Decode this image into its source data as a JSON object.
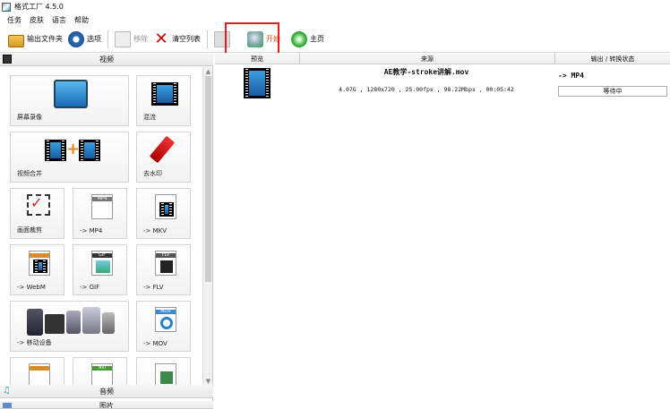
{
  "window": {
    "title": "格式工厂 4.5.0"
  },
  "menu": [
    "任务",
    "皮肤",
    "语言",
    "帮助"
  ],
  "toolbar": {
    "output_folder": "输出文件夹",
    "options": "选项",
    "remove": "移除",
    "clear_list": "清空列表",
    "reorder": "",
    "start": "开始",
    "home": "主页"
  },
  "sections": {
    "video": "视频",
    "audio": "音频",
    "image": "图片"
  },
  "tiles": [
    {
      "label": "屏幕录像",
      "icon": "screen-record-icon"
    },
    {
      "label": "混流",
      "icon": "mux-icon"
    },
    {
      "label": "视频合并",
      "icon": "video-merge-icon"
    },
    {
      "label": "去水印",
      "icon": "remove-watermark-icon"
    },
    {
      "label": "画面裁剪",
      "icon": "crop-icon"
    },
    {
      "label": "-> MP4",
      "icon": "mp4-icon"
    },
    {
      "label": "-> MKV",
      "icon": "mkv-icon"
    },
    {
      "label": "-> WebM",
      "icon": "webm-icon"
    },
    {
      "label": "-> GIF",
      "icon": "gif-icon"
    },
    {
      "label": "-> FLV",
      "icon": "flv-icon"
    },
    {
      "label": "-> 移动设备",
      "icon": "mobile-device-icon"
    },
    {
      "label": "-> MOV",
      "icon": "mov-icon"
    },
    {
      "label": "",
      "icon": "format-icon"
    },
    {
      "label": "",
      "icon": "avi-icon"
    },
    {
      "label": "",
      "icon": "format-icon"
    }
  ],
  "doc_tags": {
    "mp4": "MP4",
    "gif": "GIF",
    "flv": "FLV",
    "mov": "MOV",
    "avi": "AVI"
  },
  "table": {
    "headers": {
      "preview": "预览",
      "source": "来源",
      "output": "输出 / 转换状态"
    },
    "rows": [
      {
        "filename": "AE教学-stroke讲解.mov",
        "info": "4.07G , 1280x720 , 25.00fps , 98.22Mbps , 00:05:42",
        "output": "-> MP4",
        "status": "等待中"
      }
    ]
  },
  "colors": {
    "highlight": "#e02020",
    "start_text": "#d4561a"
  }
}
